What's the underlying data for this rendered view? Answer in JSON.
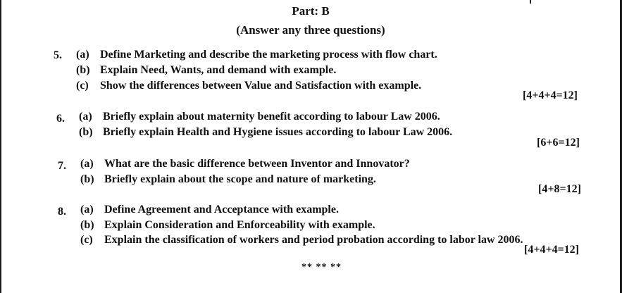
{
  "part": {
    "title": "Part: B",
    "instruction": "(Answer any three questions)"
  },
  "questions": [
    {
      "number": "5.",
      "items": [
        {
          "label": "(a)",
          "text": "Define Marketing and describe the marketing process with flow chart."
        },
        {
          "label": "(b)",
          "text": "Explain Need, Wants, and demand with example."
        },
        {
          "label": "(c)",
          "text": "Show the differences between Value and Satisfaction with example."
        }
      ],
      "marks": "[4+4+4=12]"
    },
    {
      "number": "6.",
      "items": [
        {
          "label": "(a)",
          "text": "Briefly explain about maternity benefit according to labour Law 2006."
        },
        {
          "label": "(b)",
          "text": "Briefly explain Health and Hygiene issues according to labour Law 2006."
        }
      ],
      "marks": "[6+6=12]"
    },
    {
      "number": "7.",
      "items": [
        {
          "label": "(a)",
          "text": "What are the basic difference between Inventor and Innovator?"
        },
        {
          "label": "(b)",
          "text": "Briefly explain about the scope and nature of marketing."
        }
      ],
      "marks": "[4+8=12]"
    },
    {
      "number": "8.",
      "items": [
        {
          "label": "(a)",
          "text": "Define Agreement and Acceptance with example."
        },
        {
          "label": "(b)",
          "text": "Explain Consideration and Enforceability with example."
        },
        {
          "label": "(c)",
          "text": "Explain the classification of workers and period probation according to labor law 2006."
        }
      ],
      "marks": "[4+4+4=12]"
    }
  ],
  "end_marker": "** ** **"
}
